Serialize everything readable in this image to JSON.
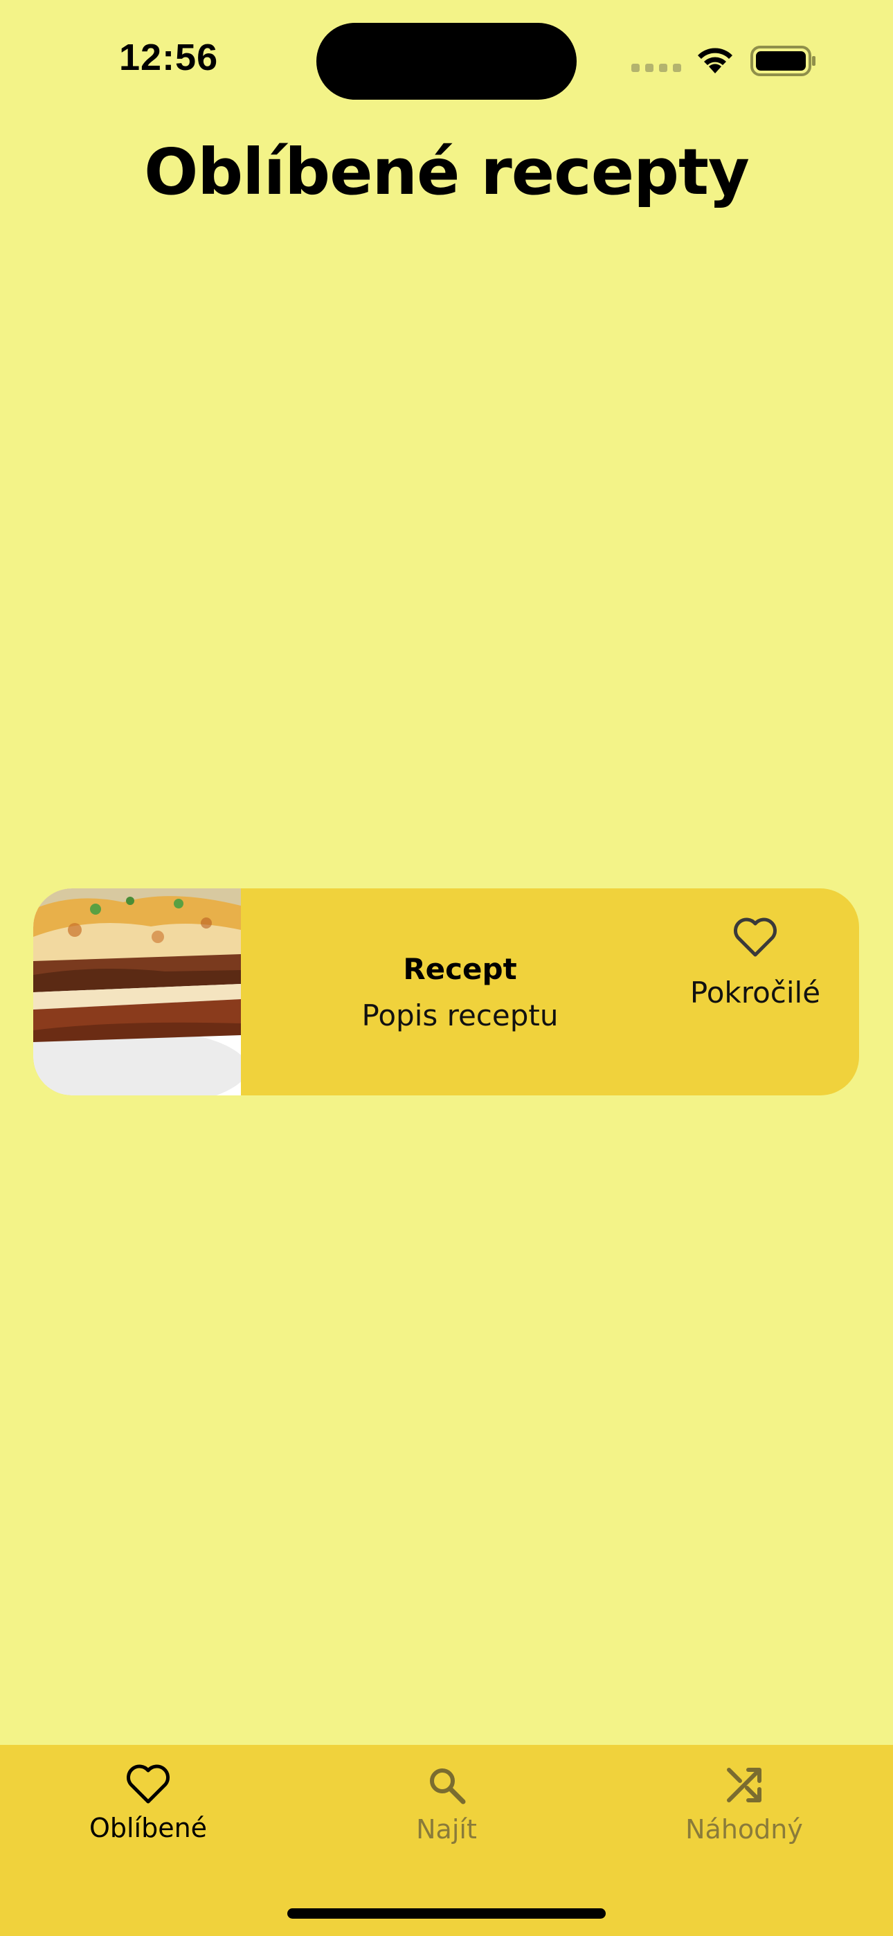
{
  "status_bar": {
    "time": "12:56"
  },
  "header": {
    "title": "Oblíbené recepty"
  },
  "recipe_card": {
    "title": "Recept",
    "description": "Popis receptu",
    "difficulty": "Pokročilé",
    "favorite_icon": "heart-outline-icon",
    "image": "lasagna-photo"
  },
  "tab_bar": {
    "tabs": [
      {
        "label": "Oblíbené",
        "icon": "heart-icon",
        "active": true
      },
      {
        "label": "Najít",
        "icon": "search-icon",
        "active": false
      },
      {
        "label": "Náhodný",
        "icon": "shuffle-icon",
        "active": false
      }
    ]
  },
  "colors": {
    "background": "#f3f388",
    "accent": "#f0d23c",
    "inactive_tab": "#8a7b3a"
  }
}
